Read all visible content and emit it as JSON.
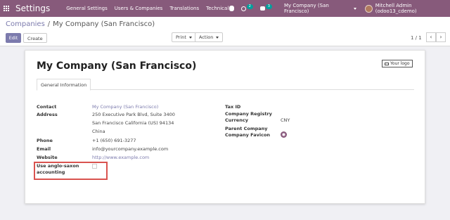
{
  "navbar": {
    "app_title": "Settings",
    "menu": [
      "General Settings",
      "Users & Companies",
      "Translations",
      "Technical"
    ],
    "activities_count": "2",
    "messages_count": "3",
    "company": "My Company (San Francisco)",
    "user": "Mitchell Admin (odoo13_cdemo)"
  },
  "breadcrumb": {
    "parent": "Companies",
    "separator": "/",
    "current": "My Company (San Francisco)"
  },
  "toolbar": {
    "edit": "Edit",
    "create": "Create",
    "print": "Print",
    "action": "Action"
  },
  "pager": {
    "value": "1 / 1",
    "prev": "‹",
    "next": "›"
  },
  "record": {
    "name": "My Company (San Francisco)",
    "logo_button": "Your logo",
    "tab": "General Information",
    "left_fields": {
      "contact_label": "Contact",
      "contact_value": "My Company (San Francisco)",
      "address_label": "Address",
      "address_line1": "250 Executive Park Blvd, Suite 3400",
      "address_line2": "San Francisco  California (US)  94134",
      "address_line3": "China",
      "phone_label": "Phone",
      "phone_value": "+1 (650) 691-3277",
      "email_label": "Email",
      "email_value": "info@yourcompany.example.com",
      "website_label": "Website",
      "website_value": "http://www.example.com",
      "anglo_label_1": "Use anglo-saxon",
      "anglo_label_2": "accounting"
    },
    "right_fields": {
      "tax_label": "Tax ID",
      "registry_label": "Company Registry",
      "currency_label": "Currency",
      "currency_value": "CNY",
      "parent_label": "Parent Company",
      "favicon_label": "Company Favicon"
    }
  },
  "colors": {
    "brand": "#875a7b",
    "link": "#7c7bad",
    "highlight": "#d9534f"
  }
}
